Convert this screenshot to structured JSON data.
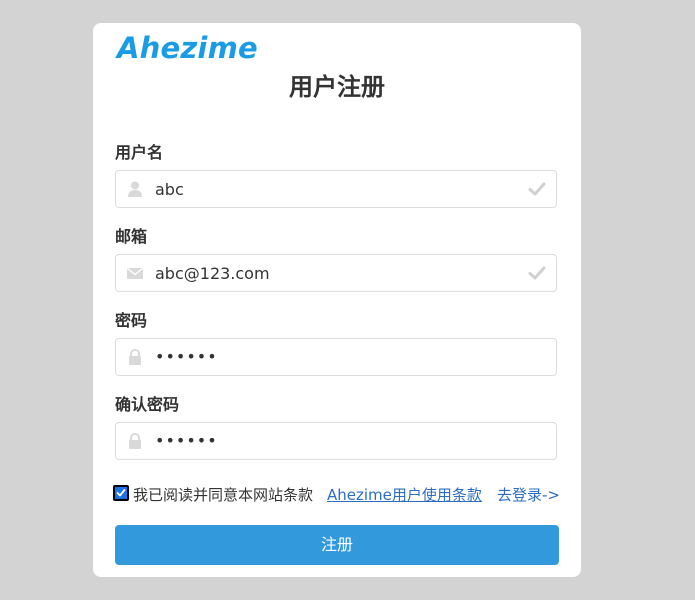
{
  "brand": "Ahezime",
  "title": "用户注册",
  "fields": [
    {
      "label": "用户名",
      "value": "abc",
      "icon": "user-icon",
      "valid": true
    },
    {
      "label": "邮箱",
      "value": "abc@123.com",
      "icon": "mail-icon",
      "valid": true
    },
    {
      "label": "密码",
      "value": "••••••",
      "icon": "lock-icon",
      "valid": false
    },
    {
      "label": "确认密码",
      "value": "••••••",
      "icon": "lock-icon",
      "valid": false
    }
  ],
  "agreement": {
    "checked": true,
    "text": "我已阅读并同意本网站条款",
    "terms_link": "Ahezime用户使用条款",
    "login_link": "去登录->"
  },
  "submit_label": "注册",
  "colors": {
    "background": "#d3d3d3",
    "card": "#ffffff",
    "brand": "#1a9be6",
    "link": "#2b6cc4",
    "button": "#3399dd",
    "icon": "#d9d9d9"
  }
}
